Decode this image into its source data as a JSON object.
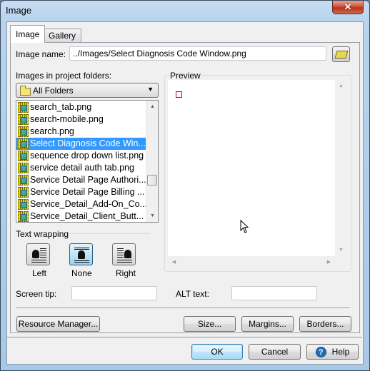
{
  "window": {
    "title": "Image",
    "close_label": "✕"
  },
  "tabs": [
    {
      "label": "Image",
      "active": true
    },
    {
      "label": "Gallery",
      "active": false
    }
  ],
  "image_name": {
    "label": "Image name:",
    "value": "../Images/Select Diagnosis Code Window.png"
  },
  "project_images": {
    "label": "Images in project folders:",
    "folder_filter": "All Folders",
    "items": [
      {
        "name": "search_tab.png",
        "selected": false
      },
      {
        "name": "search-mobile.png",
        "selected": false
      },
      {
        "name": "search.png",
        "selected": false
      },
      {
        "name": "Select Diagnosis Code Win...",
        "selected": true
      },
      {
        "name": "sequence drop down list.png",
        "selected": false
      },
      {
        "name": "service detail auth tab.png",
        "selected": false
      },
      {
        "name": "Service Detail Page Authori...",
        "selected": false
      },
      {
        "name": "Service Detail Page Billing ...",
        "selected": false
      },
      {
        "name": "Service_Detail_Add-On_Co...",
        "selected": false
      },
      {
        "name": "Service_Detail_Client_Butt...",
        "selected": false
      }
    ]
  },
  "preview": {
    "label": "Preview"
  },
  "text_wrapping": {
    "label": "Text wrapping",
    "options": [
      {
        "label": "Left",
        "selected": false
      },
      {
        "label": "None",
        "selected": true
      },
      {
        "label": "Right",
        "selected": false
      }
    ]
  },
  "screen_tip": {
    "label": "Screen tip:",
    "value": ""
  },
  "alt_text": {
    "label": "ALT text:",
    "value": ""
  },
  "buttons": {
    "resource_manager": "Resource Manager...",
    "size": "Size...",
    "margins": "Margins...",
    "borders": "Borders...",
    "ok": "OK",
    "cancel": "Cancel",
    "help": "Help"
  },
  "colors": {
    "selection": "#3399ff",
    "preview_marker": "#e00000",
    "close_button": "#c8432b"
  }
}
